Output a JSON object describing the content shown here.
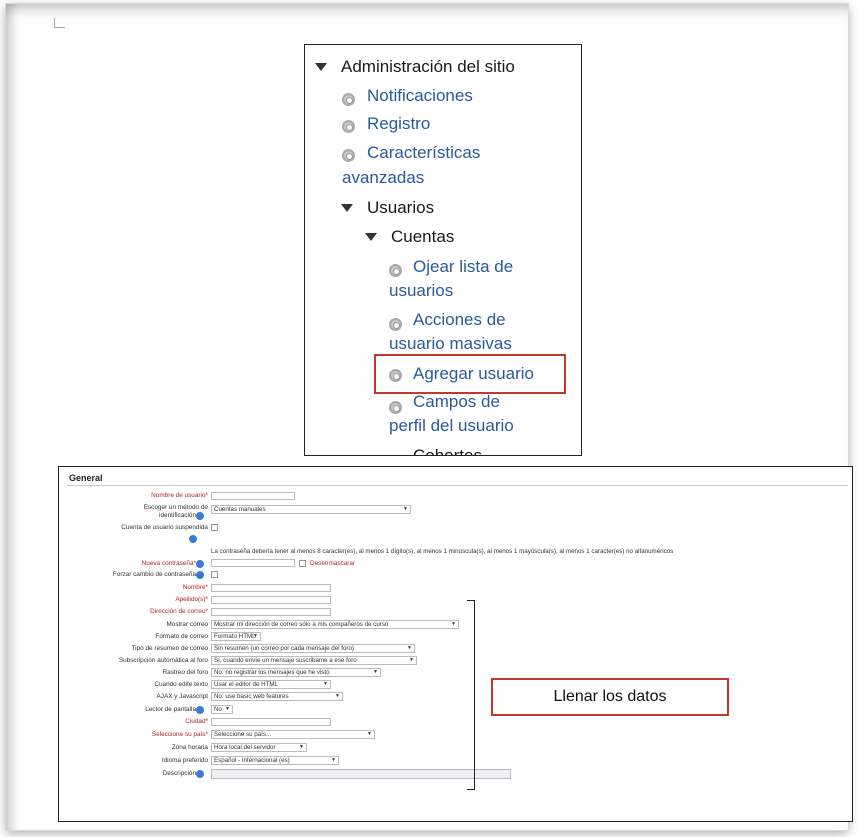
{
  "nav_tree": {
    "site_admin": "Administración del sitio",
    "notifications": "Notificaciones",
    "registration": "Registro",
    "advanced_features_1": "Características",
    "advanced_features_2": "avanzadas",
    "users": "Usuarios",
    "accounts": "Cuentas",
    "browse_users_1": "Ojear lista de",
    "browse_users_2": "usuarios",
    "bulk_actions_1": "Acciones de",
    "bulk_actions_2": "usuario masivas",
    "add_user": "Agregar usuario",
    "profile_fields_1": "Campos de",
    "profile_fields_2": "perfil del usuario",
    "cut_off": "Cohortes"
  },
  "form": {
    "legend": "General",
    "username": "Nombre de usuario*",
    "auth_label_1": "Escoger un método de",
    "auth_label_2": "identificación",
    "auth_value": "Cuentas manuales",
    "suspended_label": "Cuenta de usuario suspendida",
    "password_note": "La contraseña debería tener al menos 8 caracter(es), al menos 1 dígito(s), al menos 1 minúscula(s), al menos 1 mayúscula(s), al menos 1 caracter(es) no alfanuméricos",
    "new_password": "Nueva contraseña*",
    "unmask": "Desenmascarar",
    "force_change": "Forzar cambio de contraseña",
    "firstname": "Nombre*",
    "lastname": "Apellido(s)*",
    "email": "Dirección de correo*",
    "maildisplay_label": "Mostrar correo",
    "maildisplay_value": "Mostrar mi dirección de correo sólo a mis compañeros de curso",
    "mailformat_label": "Formato de correo",
    "mailformat_value": "Formato HTML",
    "maildigest_label": "Tipo de resumen de correo",
    "maildigest_value": "Sin resumen (un correo por cada mensaje del foro)",
    "autosubscribe_label": "Subscripción automática al foro",
    "autosubscribe_value": "Sí, cuando envíe un mensaje suscribame a ese foro",
    "trackforums_label": "Rastreo del foro",
    "trackforums_value": "No: no registrar los mensajes que he visto",
    "htmleditor_label": "Cuando edite texto",
    "htmleditor_value": "Usar el editor de HTML",
    "ajax_label": "AJAX y Javascript",
    "ajax_value": "No: use basic web features",
    "screenreader_label": "Lector de pantalla",
    "screenreader_value": "No",
    "city": "Ciudad*",
    "country_label": "Seleccione su país*",
    "country_value": "Seleccione su país...",
    "timezone_label": "Zona horaria",
    "timezone_value": "Hora local del servidor",
    "lang_label": "Idioma preferido",
    "lang_value": "Español - Internacional (es)",
    "description_label": "Descripción"
  },
  "annotation": {
    "fill_data": "Llenar los datos"
  },
  "colors": {
    "link": "#2a5a9a",
    "highlight": "#c0392b",
    "required": "#b22222",
    "info": "#3a7bd5"
  }
}
